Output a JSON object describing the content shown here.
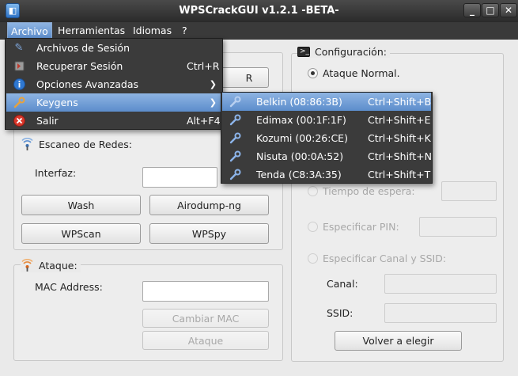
{
  "window": {
    "title": "WPSCrackGUI v1.2.1 -BETA-",
    "minimize": "_",
    "maximize": "□",
    "close": "✕"
  },
  "menubar": {
    "items": [
      "Archivo",
      "Herramientas",
      "Idiomas",
      "?"
    ]
  },
  "archivo_menu": {
    "items": [
      {
        "label": "Archivos de Sesión",
        "shortcut": "",
        "icon": "tools-icon"
      },
      {
        "label": "Recuperar Sesión",
        "shortcut": "Ctrl+R",
        "icon": "restore-icon"
      },
      {
        "label": "Opciones Avanzadas",
        "shortcut": "",
        "icon": "info-icon",
        "submenu": true
      },
      {
        "label": "Keygens",
        "shortcut": "",
        "icon": "wrench-icon",
        "submenu": true
      },
      {
        "label": "Salir",
        "shortcut": "Alt+F4",
        "icon": "exit-icon"
      }
    ]
  },
  "keygens_menu": {
    "items": [
      {
        "label": "Belkin (08:86:3B)",
        "shortcut": "Ctrl+Shift+B"
      },
      {
        "label": "Edimax (00:1F:1F)",
        "shortcut": "Ctrl+Shift+E"
      },
      {
        "label": "Kozumi (00:26:CE)",
        "shortcut": "Ctrl+Shift+K"
      },
      {
        "label": "Nisuta (00:0A:52)",
        "shortcut": "Ctrl+Shift+N"
      },
      {
        "label": "Tenda (C8:3A:35)",
        "shortcut": "Ctrl+Shift+T"
      }
    ]
  },
  "scan": {
    "title": "Escaneo de Redes:",
    "interface_label": "Interfaz:",
    "interface_value": "",
    "hidden_button_fragment": "R",
    "buttons": [
      "Wash",
      "Airodump-ng",
      "WPScan",
      "WPSpy"
    ]
  },
  "attack": {
    "title": "Ataque:",
    "mac_label": "MAC Address:",
    "mac_value": "",
    "change_mac": "Cambiar MAC",
    "attack_button": "Ataque"
  },
  "config": {
    "title": "Configuración:",
    "normal_attack": "Ataque Normal.",
    "wait_time": "Tiempo de espera:",
    "specify_pin": "Especificar PIN:",
    "specify_channel": "Especificar Canal y SSID:",
    "channel_label": "Canal:",
    "ssid_label": "SSID:",
    "back_button": "Volver a elegir"
  },
  "colors": {
    "highlight": "#6f9dd6",
    "menu_bg": "#3b3b3b",
    "titlebar": "#2e2e2e"
  }
}
